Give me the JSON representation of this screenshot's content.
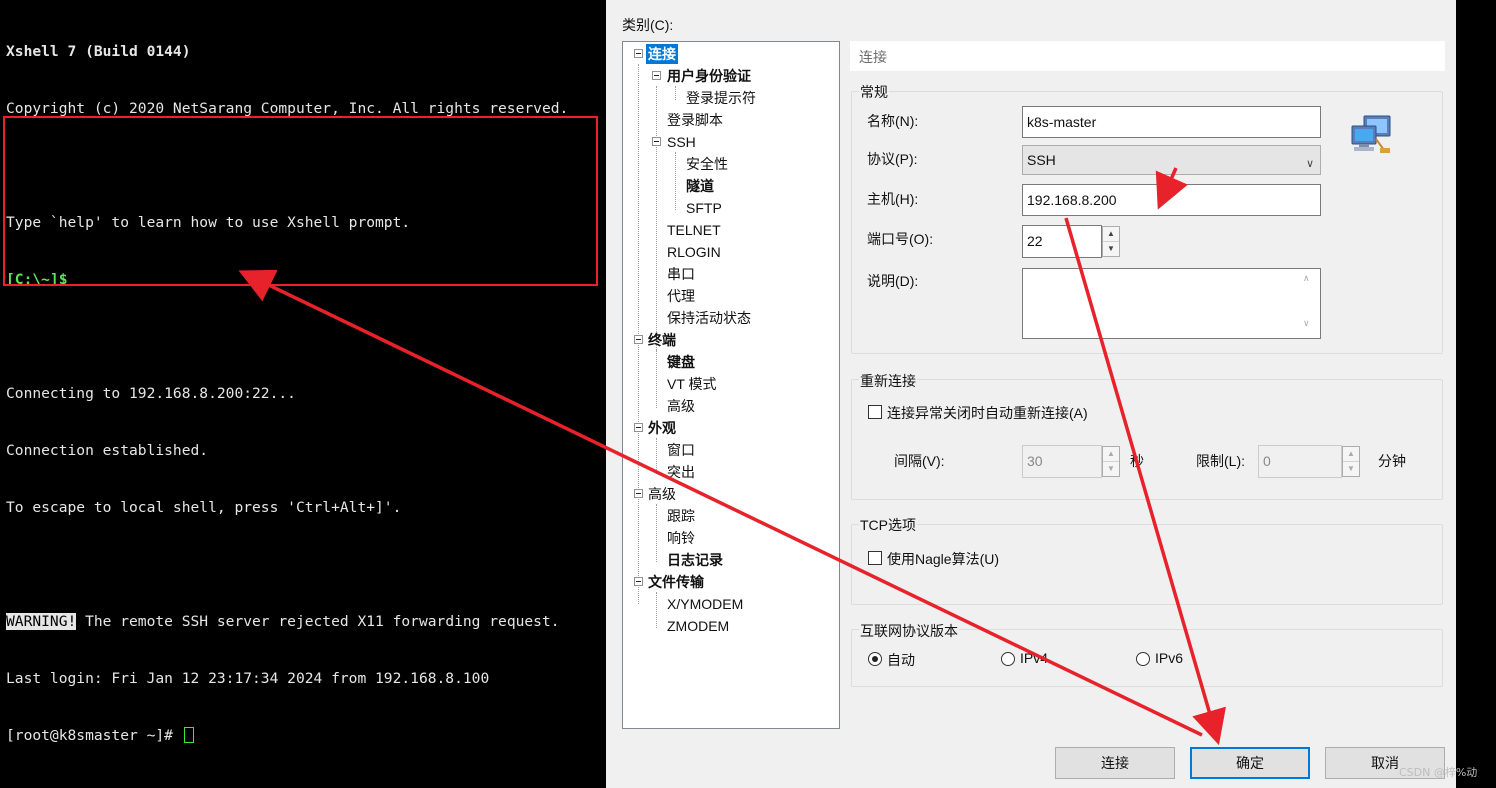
{
  "terminal": {
    "lines": [
      "Xshell 7 (Build 0144)",
      "Copyright (c) 2020 NetSarang Computer, Inc. All rights reserved.",
      "",
      "Type `help' to learn how to use Xshell prompt.",
      "[C:\\~]$",
      "",
      "Connecting to 192.168.8.200:22...",
      "Connection established.",
      "To escape to local shell, press 'Ctrl+Alt+]'.",
      ""
    ],
    "warning_tag": "WARNING!",
    "warning_text": " The remote SSH server rejected X11 forwarding request.",
    "last_login": "Last login: Fri Jan 12 23:17:34 2024 from 192.168.8.100",
    "shell_prompt": "[root@k8smaster ~]# "
  },
  "dialog": {
    "category_label": "类别(C):",
    "tree": [
      {
        "label": "连接",
        "level": 0,
        "bold": true,
        "selected": true
      },
      {
        "label": "用户身份验证",
        "level": 1,
        "bold": true
      },
      {
        "label": "登录提示符",
        "level": 2
      },
      {
        "label": "登录脚本",
        "level": 1
      },
      {
        "label": "SSH",
        "level": 1
      },
      {
        "label": "安全性",
        "level": 2
      },
      {
        "label": "隧道",
        "level": 2,
        "bold": true
      },
      {
        "label": "SFTP",
        "level": 2
      },
      {
        "label": "TELNET",
        "level": 1
      },
      {
        "label": "RLOGIN",
        "level": 1
      },
      {
        "label": "串口",
        "level": 1
      },
      {
        "label": "代理",
        "level": 1
      },
      {
        "label": "保持活动状态",
        "level": 1
      },
      {
        "label": "终端",
        "level": 0,
        "bold": true
      },
      {
        "label": "键盘",
        "level": 1,
        "bold": true
      },
      {
        "label": "VT 模式",
        "level": 1
      },
      {
        "label": "高级",
        "level": 1
      },
      {
        "label": "外观",
        "level": 0,
        "bold": true
      },
      {
        "label": "窗口",
        "level": 1
      },
      {
        "label": "突出",
        "level": 1
      },
      {
        "label": "高级",
        "level": 0
      },
      {
        "label": "跟踪",
        "level": 1
      },
      {
        "label": "响铃",
        "level": 1
      },
      {
        "label": "日志记录",
        "level": 1,
        "bold": true
      },
      {
        "label": "文件传输",
        "level": 0,
        "bold": true
      },
      {
        "label": "X/YMODEM",
        "level": 1
      },
      {
        "label": "ZMODEM",
        "level": 1
      }
    ],
    "panel_title": "连接",
    "general": {
      "title": "常规",
      "name_label": "名称(N):",
      "name_value": "k8s-master",
      "protocol_label": "协议(P):",
      "protocol_value": "SSH",
      "host_label": "主机(H):",
      "host_value": "192.168.8.200",
      "port_label": "端口号(O):",
      "port_value": "22",
      "desc_label": "说明(D):",
      "desc_value": ""
    },
    "reconnect": {
      "title": "重新连接",
      "auto_label": "连接异常关闭时自动重新连接(A)",
      "auto_checked": false,
      "interval_label": "间隔(V):",
      "interval_value": "30",
      "interval_unit": "秒",
      "limit_label": "限制(L):",
      "limit_value": "0",
      "limit_unit": "分钟"
    },
    "tcp": {
      "title": "TCP选项",
      "nagle_label": "使用Nagle算法(U)",
      "nagle_checked": false
    },
    "ip_version": {
      "title": "互联网协议版本",
      "options": [
        "自动",
        "IPv4",
        "IPv6"
      ],
      "selected": "自动"
    },
    "buttons": {
      "connect": "连接",
      "ok": "确定",
      "cancel": "取消"
    }
  },
  "watermark": "CSDN @梓%动",
  "colors": {
    "annotation_red": "#e8222a",
    "selection_blue": "#0078d7",
    "prompt_green": "#58e858"
  }
}
